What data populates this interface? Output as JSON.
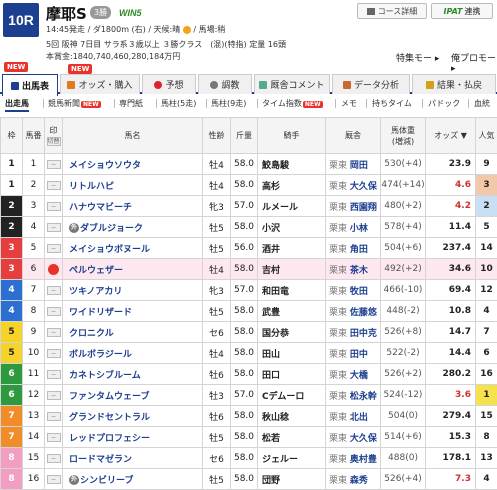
{
  "header": {
    "race_no": "10R",
    "race_name": "摩耶S",
    "grade": "3勝",
    "win5": "WIN5",
    "course_btn": "コース詳細",
    "ipat_label": "IPAT",
    "ipat_text": "連携",
    "line1": "14:45発走 / ダ1800m (右) / 天候:晴",
    "line1b": "/ 馬場:稍",
    "line2": "5回 阪神 7日目 サラ系３歳以上 ３勝クラス　(混)(特指) 定量 16頭",
    "line3": "本賞金:1840,740,460,280,184万円",
    "tokusou": "特集モー ▸",
    "oreplo": "俺プロモー ▸"
  },
  "tabs": [
    {
      "label": "出馬表"
    },
    {
      "label": "オッズ・購入"
    },
    {
      "label": "予想"
    },
    {
      "label": "調教"
    },
    {
      "label": "厩舎コメント"
    },
    {
      "label": "データ分析"
    },
    {
      "label": "結果・払戻"
    }
  ],
  "new_badges": [
    "NEW",
    "NEW"
  ],
  "subnav": [
    {
      "label": "出走馬"
    },
    {
      "label": "競馬新聞",
      "new": "NEW"
    },
    {
      "label": "専門紙"
    },
    {
      "label": "馬柱(5走)"
    },
    {
      "label": "馬柱(9走)"
    },
    {
      "label": "タイム指数",
      "new": "NEW"
    },
    {
      "label": "メモ"
    },
    {
      "label": "持ちタイム"
    },
    {
      "label": "パドック"
    },
    {
      "label": "血統"
    }
  ],
  "columns": {
    "waku": "枠",
    "num": "馬番",
    "mark": "印",
    "mark_sub": "切替",
    "name": "馬名",
    "sexage": "性齢",
    "weight": "斤量",
    "jockey": "騎手",
    "trainer": "厩舎",
    "bw": "馬体重",
    "bw_sub": "(増減)",
    "odds": "オッズ",
    "odds_sort": "▼",
    "pop": "人気"
  },
  "rows": [
    {
      "waku": "1",
      "num": "1",
      "name": "メイショウソウタ",
      "sexage": "牡4",
      "wt": "58.0",
      "jockey": "鮫島駿",
      "zone": "栗東",
      "trainer": "岡田",
      "bw": "530(+4)",
      "odds": "23.9",
      "pop": "9"
    },
    {
      "waku": "1",
      "num": "2",
      "name": "リトルハピ",
      "sexage": "牡4",
      "wt": "58.0",
      "jockey": "高杉",
      "zone": "栗東",
      "trainer": "大久保",
      "bw": "474(+14)",
      "odds": "4.6",
      "pop": "3"
    },
    {
      "waku": "2",
      "num": "3",
      "name": "ハナウマビーチ",
      "sexage": "牝3",
      "wt": "57.0",
      "jockey": "ルメール",
      "zone": "栗東",
      "trainer": "西園翔",
      "bw": "480(+2)",
      "odds": "4.2",
      "pop": "2"
    },
    {
      "waku": "2",
      "num": "4",
      "name": "ダブルジョーク",
      "sexage": "牡5",
      "wt": "58.0",
      "jockey": "小沢",
      "zone": "栗東",
      "trainer": "小林",
      "bw": "578(+4)",
      "odds": "11.4",
      "pop": "5",
      "icon": "外"
    },
    {
      "waku": "3",
      "num": "5",
      "name": "メイショウボヌール",
      "sexage": "牡5",
      "wt": "56.0",
      "jockey": "酒井",
      "zone": "栗東",
      "trainer": "角田",
      "bw": "504(+6)",
      "odds": "237.4",
      "pop": "14"
    },
    {
      "waku": "3",
      "num": "6",
      "name": "ペルウェザー",
      "sexage": "牡4",
      "wt": "58.0",
      "jockey": "吉村",
      "zone": "栗東",
      "trainer": "茶木",
      "bw": "492(+2)",
      "odds": "34.6",
      "pop": "10",
      "hl": true
    },
    {
      "waku": "4",
      "num": "7",
      "name": "ツキノアカリ",
      "sexage": "牝3",
      "wt": "57.0",
      "jockey": "和田竜",
      "zone": "栗東",
      "trainer": "牧田",
      "bw": "466(-10)",
      "odds": "69.4",
      "pop": "12"
    },
    {
      "waku": "4",
      "num": "8",
      "name": "ワイドリザード",
      "sexage": "牡5",
      "wt": "58.0",
      "jockey": "武豊",
      "zone": "栗東",
      "trainer": "佐藤悠",
      "bw": "448(-2)",
      "odds": "10.8",
      "pop": "4"
    },
    {
      "waku": "5",
      "num": "9",
      "name": "クロニクル",
      "sexage": "セ6",
      "wt": "58.0",
      "jockey": "国分恭",
      "zone": "栗東",
      "trainer": "田中克",
      "bw": "526(+8)",
      "odds": "14.7",
      "pop": "7"
    },
    {
      "waku": "5",
      "num": "10",
      "name": "ボルボラジール",
      "sexage": "牡4",
      "wt": "58.0",
      "jockey": "田山",
      "zone": "栗東",
      "trainer": "田中",
      "bw": "522(-2)",
      "odds": "14.4",
      "pop": "6"
    },
    {
      "waku": "6",
      "num": "11",
      "name": "カネトシブルーム",
      "sexage": "牡6",
      "wt": "58.0",
      "jockey": "田口",
      "zone": "栗東",
      "trainer": "大橋",
      "bw": "526(+2)",
      "odds": "280.2",
      "pop": "16"
    },
    {
      "waku": "6",
      "num": "12",
      "name": "ファンタムウェーブ",
      "sexage": "牡3",
      "wt": "57.0",
      "jockey": "Cデムーロ",
      "zone": "栗東",
      "trainer": "松永幹",
      "bw": "524(-12)",
      "odds": "3.6",
      "pop": "1"
    },
    {
      "waku": "7",
      "num": "13",
      "name": "グランドセントラル",
      "sexage": "牡6",
      "wt": "58.0",
      "jockey": "秋山稔",
      "zone": "栗東",
      "trainer": "北出",
      "bw": "504(0)",
      "odds": "279.4",
      "pop": "15"
    },
    {
      "waku": "7",
      "num": "14",
      "name": "レッドプロフェシー",
      "sexage": "牡5",
      "wt": "58.0",
      "jockey": "松若",
      "zone": "栗東",
      "trainer": "大久保",
      "bw": "514(+6)",
      "odds": "15.3",
      "pop": "8"
    },
    {
      "waku": "8",
      "num": "15",
      "name": "ロードマゼラン",
      "sexage": "セ6",
      "wt": "58.0",
      "jockey": "ジェルー",
      "zone": "栗東",
      "trainer": "奥村豊",
      "bw": "488(0)",
      "odds": "178.1",
      "pop": "13"
    },
    {
      "waku": "8",
      "num": "16",
      "name": "シンビリーブ",
      "sexage": "牡5",
      "wt": "58.0",
      "jockey": "団野",
      "zone": "栗東",
      "trainer": "森秀",
      "bw": "526(+4)",
      "odds": "7.3",
      "pop": "4",
      "icon": "外"
    }
  ],
  "colors": {
    "accent": "#1d3f8f",
    "waku1": "#ffffff",
    "waku2": "#222222",
    "waku3": "#e63d3d",
    "waku4": "#2b6fd1",
    "waku5": "#f5d328",
    "waku6": "#2f9a3d",
    "waku7": "#f28c28",
    "waku8": "#f19ec2"
  }
}
